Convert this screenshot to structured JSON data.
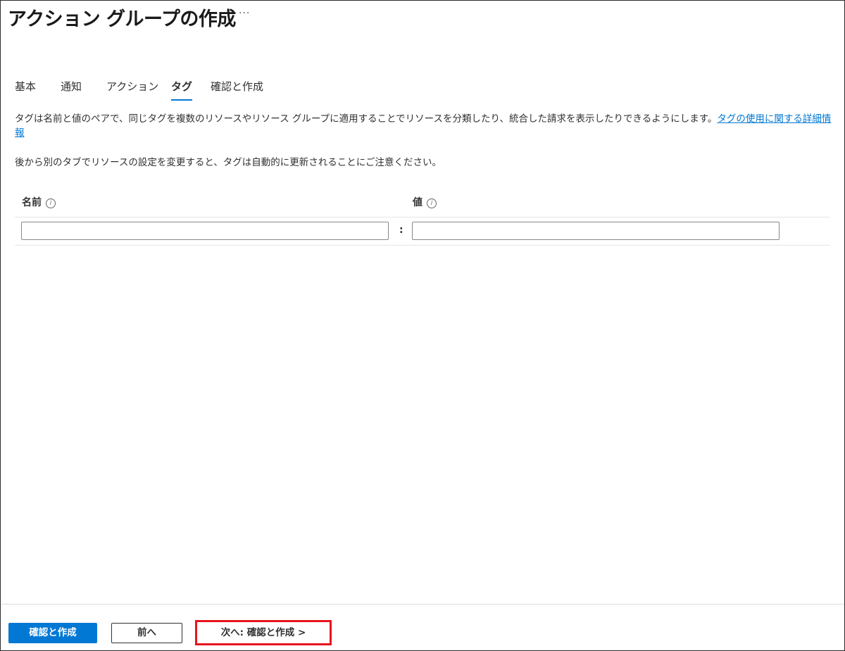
{
  "header": {
    "title": "アクション グループの作成",
    "more_label": "···"
  },
  "tabs": [
    {
      "label": "基本"
    },
    {
      "label": "通知"
    },
    {
      "label": "アクション"
    },
    {
      "label": "タグ",
      "active": true
    },
    {
      "label": "確認と作成"
    }
  ],
  "description": {
    "text": "タグは名前と値のペアで、同じタグを複数のリソースやリソース グループに適用することでリソースを分類したり、統合した請求を表示したりできるようにします。",
    "link": "タグの使用に関する詳細情報"
  },
  "note": "後から別のタブでリソースの設定を変更すると、タグは自動的に更新されることにご注意ください。",
  "tags_table": {
    "name_header": "名前",
    "value_header": "値",
    "info_icon": "ⓘ",
    "separator": ":",
    "name_value": "",
    "value_value": ""
  },
  "footer": {
    "create_label": "確認と作成",
    "prev_label": "前へ",
    "next_label": "次へ: 確認と作成 >"
  },
  "colors": {
    "accent": "#0078d4",
    "highlight": "#e8141d"
  }
}
